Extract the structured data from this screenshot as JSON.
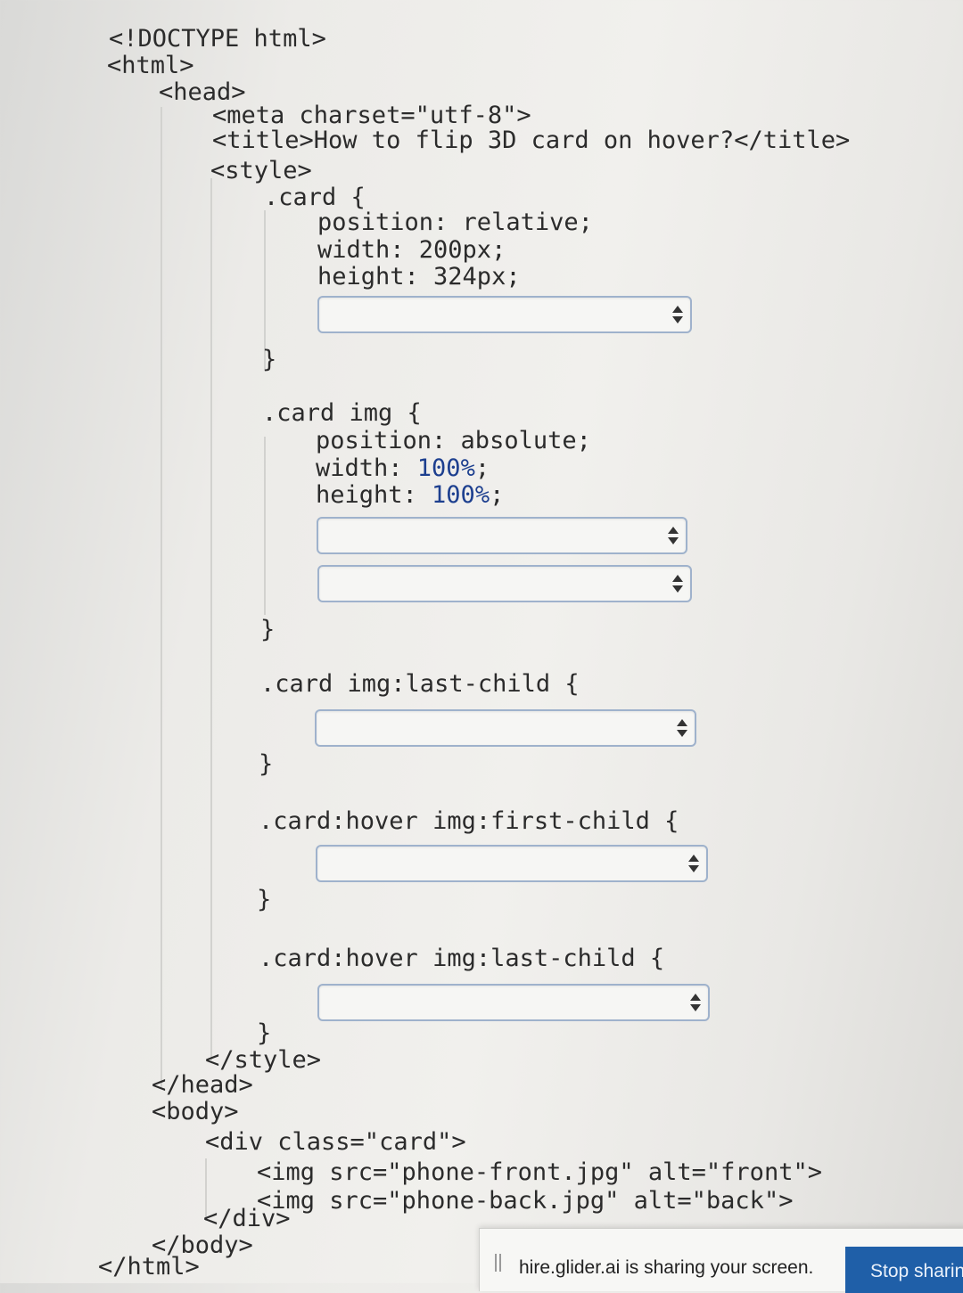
{
  "code": {
    "doctype": "<!DOCTYPE html>",
    "html_open": "<html>",
    "head_open": "<head>",
    "meta": "<meta charset=\"utf-8\">",
    "title": "<title>How to flip 3D card on hover?</title>",
    "style_open": "<style>",
    "card_selector": ".card {",
    "card_position": "position: relative;",
    "card_width": "width: 200px;",
    "card_height": "height: 324px;",
    "close_1": "}",
    "img_selector": ".card img {",
    "img_position": "position: absolute;",
    "img_width_prop": "width: ",
    "img_width_val": "100%",
    "img_height_prop": "height: ",
    "img_height_val": "100%",
    "semicolon": ";",
    "close_2": "}",
    "last_child_selector": ".card img:last-child {",
    "close_3": "}",
    "hover_first_selector": ".card:hover img:first-child {",
    "close_4": "}",
    "hover_last_selector": ".card:hover img:last-child {",
    "close_5": "}",
    "style_close": "</style>",
    "head_close": "</head>",
    "body_open": "<body>",
    "div_open": "<div class=\"card\">",
    "img_front": "<img src=\"phone-front.jpg\" alt=\"front\">",
    "img_back": "<img src=\"phone-back.jpg\" alt=\"back\">",
    "div_close": "</div>",
    "body_close": "</body>",
    "html_close": "</html>"
  },
  "dropdowns": [
    {
      "selected": ""
    },
    {
      "selected": ""
    },
    {
      "selected": ""
    },
    {
      "selected": ""
    },
    {
      "selected": ""
    },
    {
      "selected": ""
    }
  ],
  "share_bar": {
    "message": "hire.glider.ai is sharing your screen.",
    "stop_label": "Stop sharin"
  },
  "colors": {
    "number_literal": "#1d3f8f",
    "dropdown_border": "#9fb2cc",
    "stop_button": "#1f5fa8"
  }
}
